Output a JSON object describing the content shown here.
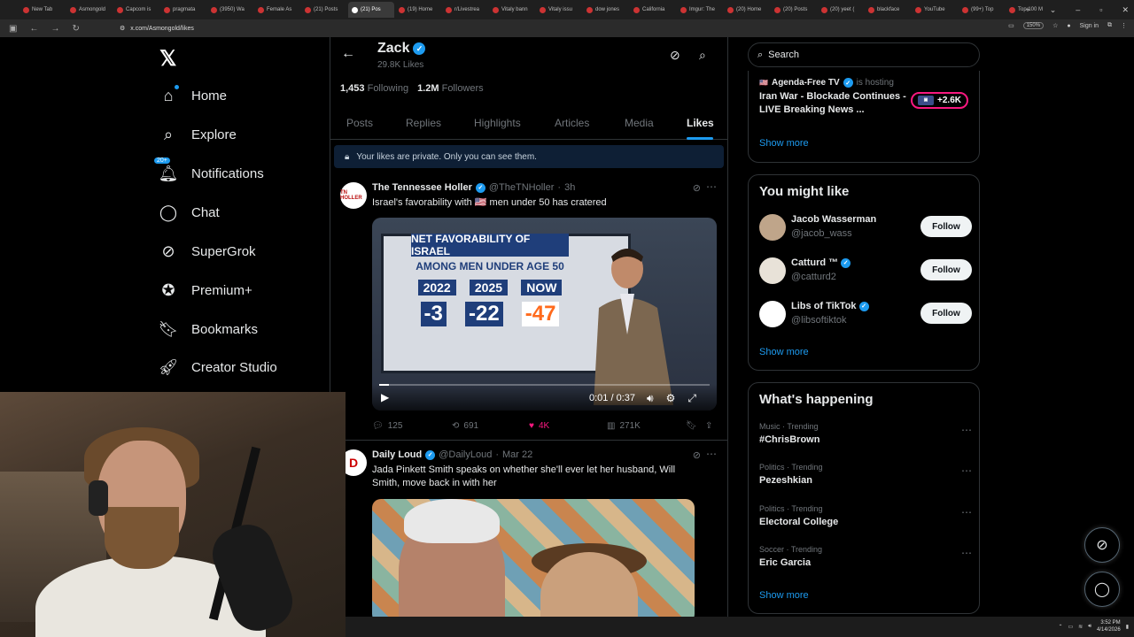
{
  "browser": {
    "tabs": [
      {
        "label": "New Tab",
        "active": false
      },
      {
        "label": "Asmongold",
        "active": false
      },
      {
        "label": "Capcom is",
        "active": false
      },
      {
        "label": "pragmata",
        "active": false
      },
      {
        "label": "(3950) Wa",
        "active": false
      },
      {
        "label": "Female As",
        "active": false
      },
      {
        "label": "(21) Posts",
        "active": false
      },
      {
        "label": "(21) Pos",
        "active": true
      },
      {
        "label": "(19) Home",
        "active": false
      },
      {
        "label": "r/Livestrea",
        "active": false
      },
      {
        "label": "Vitaly bann",
        "active": false
      },
      {
        "label": "Vitaly issu",
        "active": false
      },
      {
        "label": "dow jones",
        "active": false
      },
      {
        "label": "California",
        "active": false
      },
      {
        "label": "Imgur: The",
        "active": false
      },
      {
        "label": "(20) Home",
        "active": false
      },
      {
        "label": "(20) Posts",
        "active": false
      },
      {
        "label": "(20) yeet (",
        "active": false
      },
      {
        "label": "blackface",
        "active": false
      },
      {
        "label": "YouTube",
        "active": false
      },
      {
        "label": "(99+) Top",
        "active": false
      },
      {
        "label": "Top 100 M",
        "active": false
      }
    ],
    "url": "x.com/Asmongold/likes",
    "zoom": "150%",
    "signin": "Sign in"
  },
  "nav": {
    "logo": "𝕏",
    "items": [
      {
        "label": "Home",
        "icon": "home-icon"
      },
      {
        "label": "Explore",
        "icon": "search-icon"
      },
      {
        "label": "Notifications",
        "icon": "bell-icon",
        "badge": "20+"
      },
      {
        "label": "Chat",
        "icon": "chat-icon"
      },
      {
        "label": "SuperGrok",
        "icon": "grok-icon"
      },
      {
        "label": "Premium+",
        "icon": "premium-icon"
      },
      {
        "label": "Bookmarks",
        "icon": "bookmark-icon"
      },
      {
        "label": "Creator Studio",
        "icon": "rocket-icon"
      }
    ]
  },
  "profile": {
    "name": "Zack",
    "likes_count": "29.8K Likes",
    "following_count": "1,453",
    "following_label": "Following",
    "followers_count": "1.2M",
    "followers_label": "Followers",
    "tabs": [
      "Posts",
      "Replies",
      "Highlights",
      "Articles",
      "Media",
      "Likes"
    ],
    "active_tab": "Likes",
    "private_notice": "Your likes are private. Only you can see them."
  },
  "tweets": [
    {
      "name": "The Tennessee Holler",
      "handle": "@TheTNHoller",
      "time": "3h",
      "avatar_text": "TN HOLLER",
      "text": "Israel's favorability with 🇺🇸 men under 50 has cratered",
      "video": {
        "banner": "NET FAVORABILITY OF ISRAEL",
        "subtitle": "AMONG MEN UNDER AGE 50",
        "years": [
          "2022",
          "2025",
          "NOW"
        ],
        "values": [
          "-3",
          "-22",
          "-47"
        ],
        "time": "0:01 / 0:37",
        "progress": 0.03
      },
      "replies": "125",
      "reposts": "691",
      "likes": "4K",
      "views": "271K"
    },
    {
      "name": "Daily Loud",
      "handle": "@DailyLoud",
      "time": "Mar 22",
      "avatar_text": "D",
      "text": "Jada Pinkett Smith speaks on whether she'll ever let her husband, Will Smith, move back in with her"
    }
  ],
  "right": {
    "search_placeholder": "Search",
    "live": {
      "host": "Agenda-Free TV",
      "status": "is hosting",
      "title": "Iran War - Blockade Continues - LIVE Breaking News ...",
      "count": "+2.6K",
      "show_more": "Show more"
    },
    "who_to_follow": {
      "title": "You might like",
      "users": [
        {
          "name": "Jacob Wasserman",
          "handle": "@jacob_wass",
          "verified": false,
          "button": "Follow"
        },
        {
          "name": "Catturd ™",
          "handle": "@catturd2",
          "verified": true,
          "button": "Follow"
        },
        {
          "name": "Libs of TikTok",
          "handle": "@libsoftiktok",
          "verified": true,
          "button": "Follow"
        }
      ],
      "show_more": "Show more"
    },
    "happening": {
      "title": "What's happening",
      "trends": [
        {
          "category": "Music · Trending",
          "name": "#ChrisBrown"
        },
        {
          "category": "Politics · Trending",
          "name": "Pezeshkian"
        },
        {
          "category": "Politics · Trending",
          "name": "Electoral College"
        },
        {
          "category": "Soccer · Trending",
          "name": "Eric Garcia"
        }
      ],
      "show_more": "Show more"
    }
  },
  "taskbar": {
    "time": "3:52 PM",
    "date": "4/14/2026"
  }
}
